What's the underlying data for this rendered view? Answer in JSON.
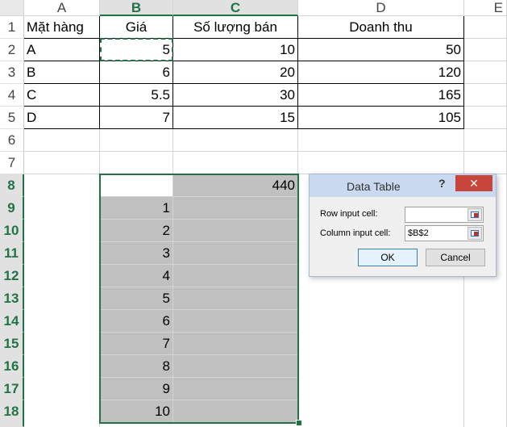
{
  "columns": [
    "A",
    "B",
    "C",
    "D",
    "E"
  ],
  "rows": [
    "1",
    "2",
    "3",
    "4",
    "5",
    "6",
    "7",
    "8",
    "9",
    "10",
    "11",
    "12",
    "13",
    "14",
    "15",
    "16",
    "17",
    "18"
  ],
  "header": {
    "item": "Mặt hàng",
    "price": "Giá",
    "quantity": "Số lượng bán",
    "revenue": "Doanh thu"
  },
  "table": [
    {
      "item": "A",
      "price": "5",
      "quantity": "10",
      "revenue": "50"
    },
    {
      "item": "B",
      "price": "6",
      "quantity": "20",
      "revenue": "120"
    },
    {
      "item": "C",
      "price": "5.5",
      "quantity": "30",
      "revenue": "165"
    },
    {
      "item": "D",
      "price": "7",
      "quantity": "15",
      "revenue": "105"
    }
  ],
  "data_table": {
    "formula_result": "440",
    "inputs": [
      "1",
      "2",
      "3",
      "4",
      "5",
      "6",
      "7",
      "8",
      "9",
      "10"
    ]
  },
  "dialog": {
    "title": "Data Table",
    "help": "?",
    "close": "✕",
    "row_input_label": "Row input cell:",
    "row_input_value": "",
    "column_input_label": "Column input cell:",
    "column_input_value": "$B$2",
    "ok_label": "OK",
    "cancel_label": "Cancel"
  },
  "colors": {
    "selection": "#217346",
    "shade": "#c0c0c0",
    "dialog_title": "#c9daf0",
    "close": "#c7453a"
  }
}
